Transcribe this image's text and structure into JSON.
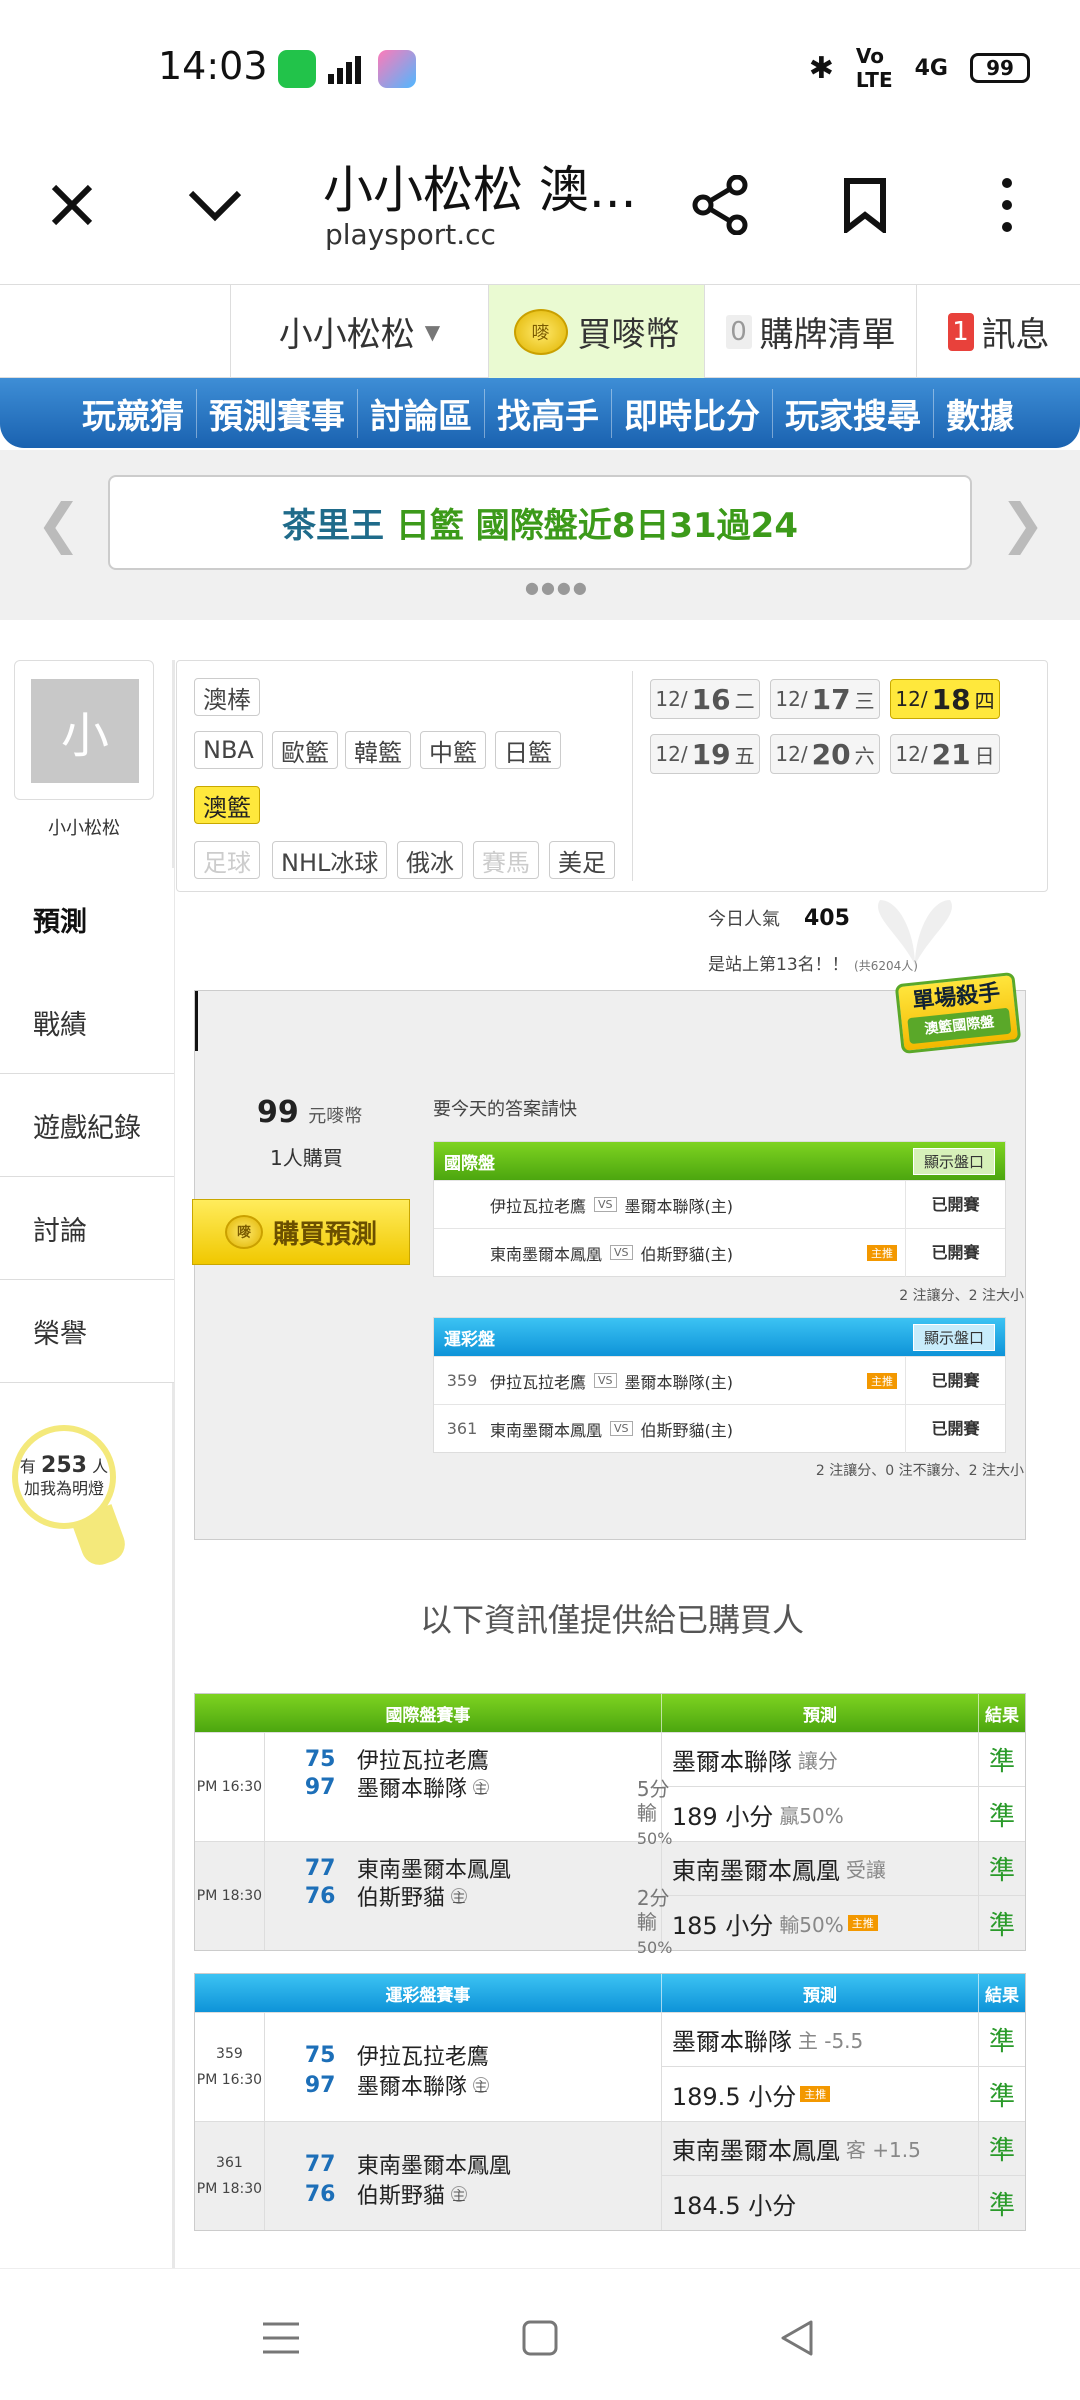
{
  "status": {
    "time": "14:03",
    "battery": "99",
    "net": "4G"
  },
  "browser": {
    "title": "小小松松 澳...",
    "url": "playsport.cc"
  },
  "topnav": {
    "user": "小小松松",
    "buy_coin": "買嘜幣",
    "cart_count": "0",
    "cart": "購牌清單",
    "msg_count": "1",
    "msg": "訊息",
    "coin_icon": "嘜"
  },
  "menu": [
    "玩競猜",
    "預測賽事",
    "討論區",
    "找高手",
    "即時比分",
    "玩家搜尋",
    "數據"
  ],
  "banner": {
    "part1": "茶里王",
    "part2": "日籃 國際盤近8日31過24",
    "dots": "●●●●"
  },
  "profile": {
    "avatar_char": "小",
    "name": "小小松松"
  },
  "sidenav": [
    "預測",
    "戰績",
    "遊戲紀錄",
    "討論",
    "榮譽"
  ],
  "fans": {
    "pre": "有",
    "count": "253",
    "unit": "人",
    "label": "加我為明燈"
  },
  "categories": {
    "row1": [
      "澳棒"
    ],
    "row2": [
      "NBA",
      "歐籃",
      "韓籃",
      "中籃",
      "日籃"
    ],
    "row3": [
      "澳籃"
    ],
    "row4": [
      "足球",
      "NHL冰球",
      "俄冰",
      "賽馬",
      "美足"
    ]
  },
  "dates": [
    {
      "md": "12/",
      "d": "16",
      "w": "二"
    },
    {
      "md": "12/",
      "d": "17",
      "w": "三"
    },
    {
      "md": "12/",
      "d": "18",
      "w": "四"
    },
    {
      "md": "12/",
      "d": "19",
      "w": "五"
    },
    {
      "md": "12/",
      "d": "20",
      "w": "六"
    },
    {
      "md": "12/",
      "d": "21",
      "w": "日"
    }
  ],
  "popularity": {
    "label": "今日人氣",
    "value": "405",
    "rank": "是站上第13名！！",
    "total": "(共6204人)"
  },
  "badge": {
    "title": "單場殺手",
    "sub": "澳籃國際盤"
  },
  "purchase": {
    "price": "99",
    "unit": "元嘜幣",
    "buyers": "1人購買",
    "button": "購買預測",
    "hint": "要今天的答案請快"
  },
  "intl": {
    "title": "國際盤",
    "show": "顯示盤口",
    "rows": [
      {
        "no": "",
        "away": "伊拉瓦拉老鷹",
        "home": "墨爾本聯隊(主)",
        "tag": "",
        "status": "已開賽"
      },
      {
        "no": "",
        "away": "東南墨爾本鳳凰",
        "home": "伯斯野貓(主)",
        "tag": "主推",
        "status": "已開賽"
      }
    ],
    "note": "2 注讓分、2 注大小"
  },
  "lottery": {
    "title": "運彩盤",
    "show": "顯示盤口",
    "rows": [
      {
        "no": "359",
        "away": "伊拉瓦拉老鷹",
        "home": "墨爾本聯隊(主)",
        "tag": "主推",
        "status": "已開賽"
      },
      {
        "no": "361",
        "away": "東南墨爾本鳳凰",
        "home": "伯斯野貓(主)",
        "tag": "",
        "status": "已開賽"
      }
    ],
    "note": "2 注讓分、0 注不讓分、2 注大小"
  },
  "info": "以下資訊僅提供給已購買人",
  "r1": {
    "h_game": "國際盤賽事",
    "h_pred": "預測",
    "h_res": "結果",
    "groups": [
      {
        "no": "",
        "time": "PM 16:30",
        "s1": "75",
        "t1": "伊拉瓦拉老鷹",
        "s2": "97",
        "t2": "墨爾本聯隊",
        "loss": "5分輸",
        "pct": "50%",
        "p1": "墨爾本聯隊",
        "p1e": "讓分",
        "p2": "189 小分",
        "p2e": "贏50%",
        "p2tag": "",
        "res1": "準",
        "res2": "準"
      },
      {
        "no": "",
        "time": "PM 18:30",
        "s1": "77",
        "t1": "東南墨爾本鳳凰",
        "s2": "76",
        "t2": "伯斯野貓",
        "loss": "2分輸",
        "pct": "50%",
        "p1": "東南墨爾本鳳凰",
        "p1e": "受讓",
        "p2": "185 小分",
        "p2e": "輸50%",
        "p2tag": "主推",
        "res1": "準",
        "res2": "準"
      }
    ]
  },
  "r2": {
    "h_game": "運彩盤賽事",
    "h_pred": "預測",
    "h_res": "結果",
    "groups": [
      {
        "no": "359",
        "time": "PM 16:30",
        "s1": "75",
        "t1": "伊拉瓦拉老鷹",
        "s2": "97",
        "t2": "墨爾本聯隊",
        "p1": "墨爾本聯隊",
        "p1e": "主 -5.5",
        "p2": "189.5 小分",
        "p2tag": "主推",
        "res1": "準",
        "res2": "準"
      },
      {
        "no": "361",
        "time": "PM 18:30",
        "s1": "77",
        "t1": "東南墨爾本鳳凰",
        "s2": "76",
        "t2": "伯斯野貓",
        "p1": "東南墨爾本鳳凰",
        "p1e": "客 +1.5",
        "p2": "184.5 小分",
        "p2tag": "",
        "res1": "準",
        "res2": "準"
      }
    ]
  },
  "host_mark": "主",
  "vs": "VS"
}
